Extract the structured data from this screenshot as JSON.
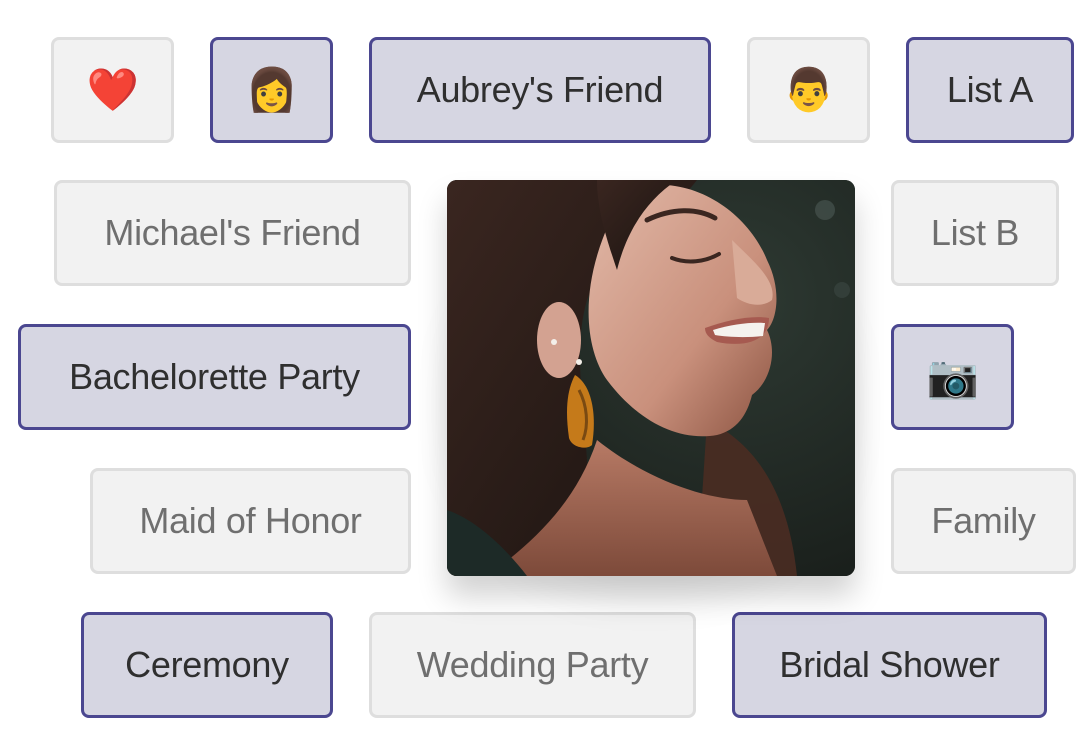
{
  "tags": {
    "heart": {
      "kind": "emoji",
      "icon": "heart-icon",
      "glyph": "❤️",
      "selected": false
    },
    "woman": {
      "kind": "emoji",
      "icon": "woman-icon",
      "glyph": "👩",
      "selected": true
    },
    "aubreys_friend": {
      "kind": "text",
      "label": "Aubrey's Friend",
      "selected": true
    },
    "man": {
      "kind": "emoji",
      "icon": "man-icon",
      "glyph": "👨",
      "selected": false
    },
    "list_a": {
      "kind": "text",
      "label": "List A",
      "selected": true
    },
    "michaels_friend": {
      "kind": "text",
      "label": "Michael's Friend",
      "selected": false
    },
    "list_b": {
      "kind": "text",
      "label": "List B",
      "selected": false
    },
    "bachelorette_party": {
      "kind": "text",
      "label": "Bachelorette Party",
      "selected": true
    },
    "camera": {
      "kind": "emoji",
      "icon": "camera-icon",
      "glyph": "📷",
      "selected": true
    },
    "maid_of_honor": {
      "kind": "text",
      "label": "Maid of Honor",
      "selected": false
    },
    "family": {
      "kind": "text",
      "label": "Family",
      "selected": false
    },
    "ceremony": {
      "kind": "text",
      "label": "Ceremony",
      "selected": true
    },
    "wedding_party": {
      "kind": "text",
      "label": "Wedding Party",
      "selected": false
    },
    "bridal_shower": {
      "kind": "text",
      "label": "Bridal Shower",
      "selected": true
    }
  },
  "photo": {
    "description": "Smiling woman with dark hair and orange earring, eyes closed"
  },
  "colors": {
    "selected_bg": "#d6d6e2",
    "selected_border": "#4b4790",
    "unselected_bg": "#f2f2f2",
    "unselected_border": "#dedede",
    "selected_text": "#2f2f2f",
    "unselected_text": "#6f6f6f"
  }
}
